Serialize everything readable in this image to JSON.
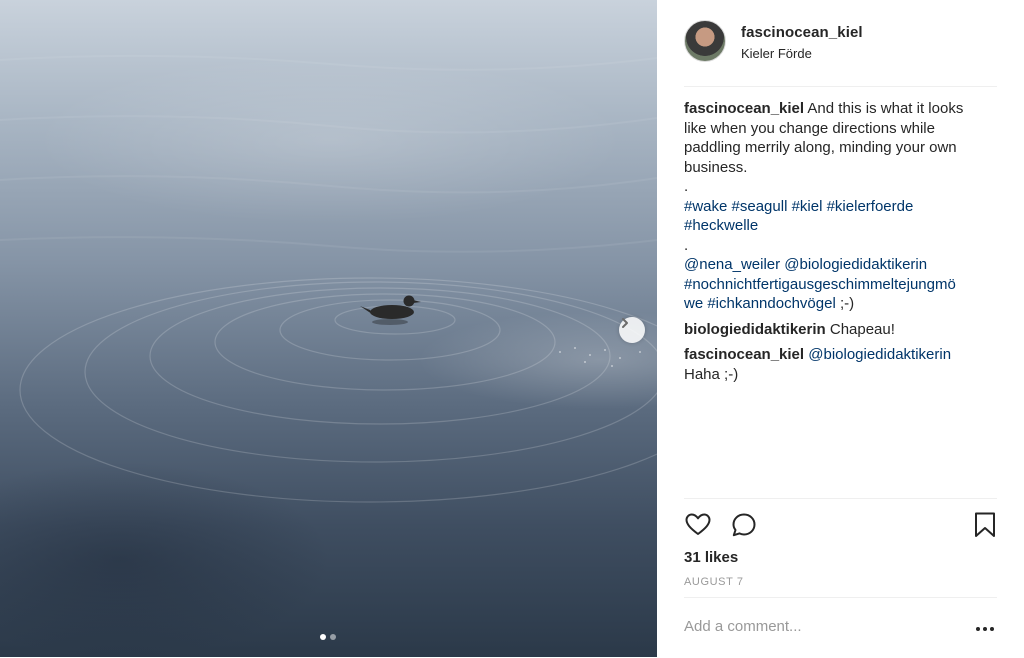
{
  "post": {
    "username": "fascinocean_kiel",
    "location": "Kieler Förde",
    "caption_lines": {
      "l1": "And this is what it looks",
      "l2": "like when you change directions while",
      "l3": "paddling merrily along, minding your own",
      "l4": "business.",
      "dot1": ".",
      "tags1": "#wake #seagull #kiel #kielerfoerde",
      "tags2": "#heckwelle",
      "dot2": ".",
      "mention1": "@nena_weiler @biologiedidaktikerin",
      "mention2": "#nochnichtfertigausgeschimmeltejungmö",
      "mention3": "we #ichkanndochvögel",
      "mention3_tail": " ;-)"
    }
  },
  "comments": [
    {
      "user": "biologiedidaktikerin",
      "text": " Chapeau!"
    },
    {
      "user": "fascinocean_kiel",
      "mention": " @biologiedidaktikerin",
      "text2": "Haha ;-)"
    }
  ],
  "actions": {
    "icons": [
      "heart-icon",
      "comment-icon",
      "bookmark-icon"
    ],
    "likes": "31 likes",
    "date": "AUGUST 7"
  },
  "add_comment": {
    "placeholder": "Add a comment...",
    "more_icon": "more-options-icon"
  },
  "carousel": {
    "current": 1,
    "total": 2,
    "next_icon": "chevron-right-icon"
  }
}
